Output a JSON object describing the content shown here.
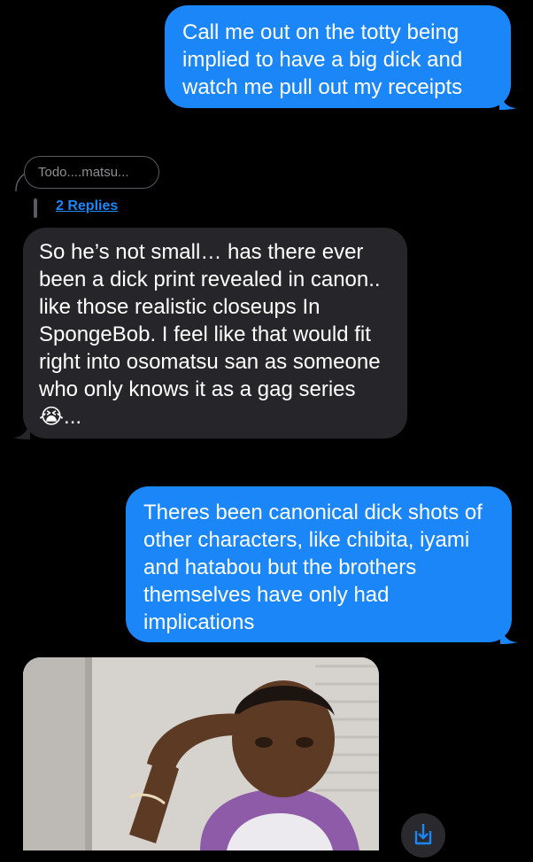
{
  "messages": [
    {
      "id": "b1",
      "direction": "outgoing",
      "text": "Call me out on the totty being implied to have a big dick and watch me pull out my receipts"
    },
    {
      "id": "b3",
      "direction": "incoming",
      "text": "So he’s not small… has there ever been a dick print revealed in canon.. like those realistic closeups In SpongeBob. I feel like that would fit right into osomatsu san as someone who only knows it as a gag series 😭..."
    },
    {
      "id": "b2",
      "direction": "outgoing",
      "text": "Theres been canonical dick shots of other characters, like chibita, iyami and hatabou but the brothers themselves have only had implications"
    }
  ],
  "reply_preview": {
    "text": "Todo....matsu...",
    "replies_label": "2 Replies"
  },
  "colors": {
    "outgoing": "#1b86f8",
    "incoming": "#26262a",
    "background": "#000000"
  },
  "icons": {
    "save": "save-icon"
  }
}
